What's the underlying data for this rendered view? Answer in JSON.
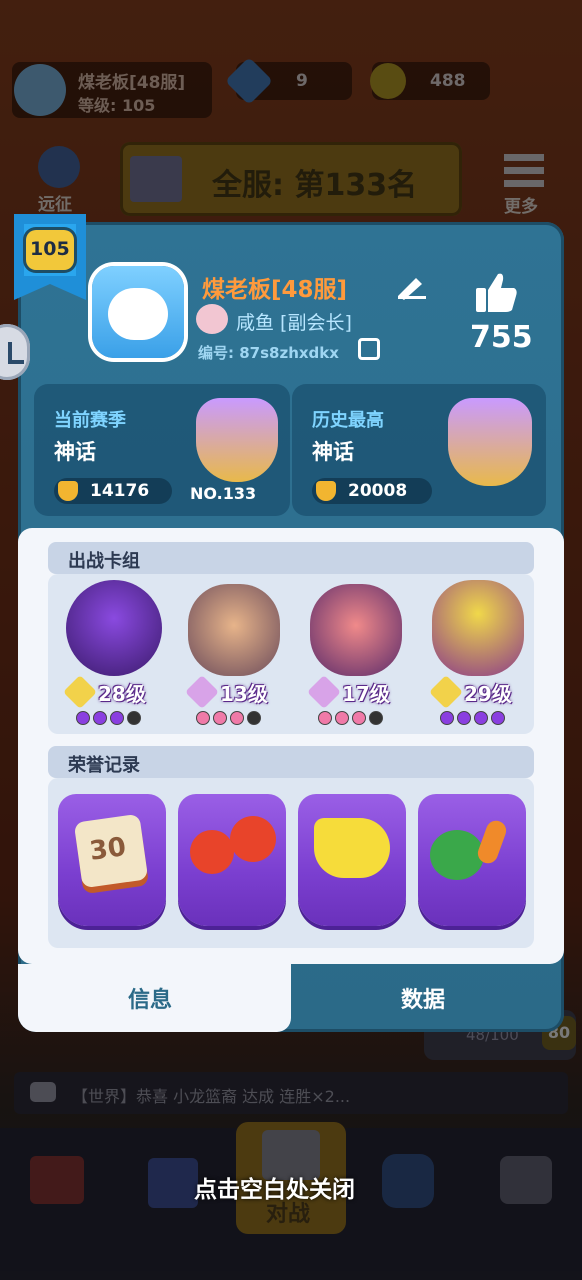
{
  "player_chip": {
    "name": "煤老板[48服]",
    "level_text": "等级: 105"
  },
  "currency": {
    "gems": "9",
    "coins": "488"
  },
  "expedition_label": "远征",
  "more_label": "更多",
  "rank_banner": "全服: 第133名",
  "profile": {
    "level_badge": "105",
    "name": "煤老板[48服]",
    "guild": "咸鱼 [副会长]",
    "id_text": "编号: 87s8zhxdkx",
    "likes": "755"
  },
  "season": {
    "label": "当前赛季",
    "tier": "神话",
    "trophies": "14176",
    "rank": "NO.133"
  },
  "best": {
    "label": "历史最高",
    "tier": "神话",
    "trophies": "20008"
  },
  "deck": {
    "title": "出战卡组",
    "cards": [
      {
        "level": "28级",
        "dots": [
          "#8a3fe0",
          "#8a3fe0",
          "#8a3fe0",
          "#333333"
        ]
      },
      {
        "level": "13级",
        "dots": [
          "#f07aa8",
          "#f07aa8",
          "#f07aa8",
          "#333333"
        ]
      },
      {
        "level": "17级",
        "dots": [
          "#f07aa8",
          "#f07aa8",
          "#f07aa8",
          "#333333"
        ]
      },
      {
        "level": "29级",
        "dots": [
          "#8a3fe0",
          "#8a3fe0",
          "#8a3fe0",
          "#8a3fe0"
        ]
      }
    ]
  },
  "honor": {
    "title": "荣誉记录",
    "badge_number": "30"
  },
  "tabs": {
    "info": "信息",
    "data": "数据"
  },
  "bg_progress": {
    "text": "48/100",
    "level": "80"
  },
  "chat": {
    "text": "【世界】恭喜 小龙篮裔 达成 连胜×2..."
  },
  "close_hint": "点击空白处关闭",
  "battle_label": "对战",
  "colors": {
    "accent_purple": "#7b3fd0",
    "panel_blue": "#2b6a88",
    "name_orange": "#ff9a3c"
  }
}
